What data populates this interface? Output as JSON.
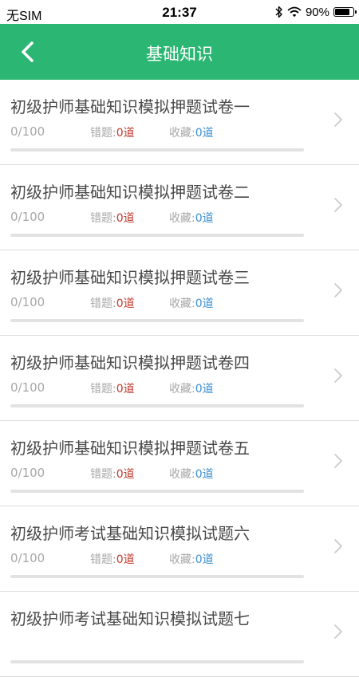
{
  "status": {
    "carrier": "无SIM",
    "time": "21:37",
    "battery_text": "90%",
    "battery_level": 0.9
  },
  "header": {
    "title": "基础知识",
    "back_icon": "chevron-left-icon"
  },
  "labels": {
    "wrong": "错题:",
    "fav": "收藏:"
  },
  "items": [
    {
      "title": "初级护师基础知识模拟押题试卷一",
      "progress": "0/100",
      "progress_value": 0,
      "wrong": "0道",
      "fav": "0道"
    },
    {
      "title": "初级护师基础知识模拟押题试卷二",
      "progress": "0/100",
      "progress_value": 0,
      "wrong": "0道",
      "fav": "0道"
    },
    {
      "title": "初级护师基础知识模拟押题试卷三",
      "progress": "0/100",
      "progress_value": 0,
      "wrong": "0道",
      "fav": "0道"
    },
    {
      "title": "初级护师基础知识模拟押题试卷四",
      "progress": "0/100",
      "progress_value": 0,
      "wrong": "0道",
      "fav": "0道"
    },
    {
      "title": "初级护师基础知识模拟押题试卷五",
      "progress": "0/100",
      "progress_value": 0,
      "wrong": "0道",
      "fav": "0道"
    },
    {
      "title": "初级护师考试基础知识模拟试题六",
      "progress": "0/100",
      "progress_value": 0,
      "wrong": "0道",
      "fav": "0道"
    },
    {
      "title": "初级护师考试基础知识模拟试题七",
      "progress": "",
      "progress_value": 0,
      "wrong": "",
      "fav": ""
    }
  ],
  "colors": {
    "accent": "#2bb673",
    "wrong": "#c0392b",
    "fav": "#3a8fd0"
  }
}
